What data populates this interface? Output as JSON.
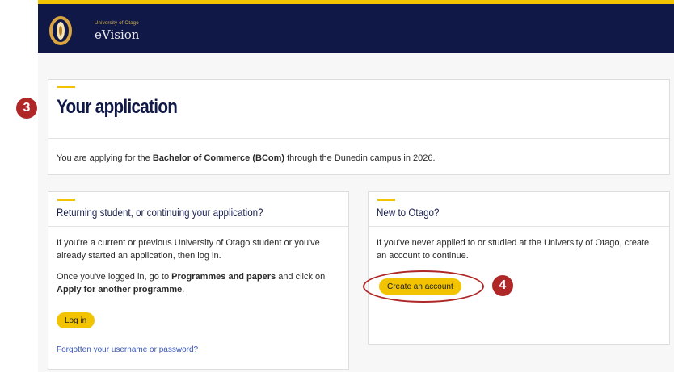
{
  "header": {
    "university_name": "University of Otago",
    "product_name": "eVision",
    "logo_icon": "otago-crest-icon",
    "colors": {
      "navy": "#0f1847",
      "gold": "#f2c300"
    }
  },
  "main": {
    "title": "Your application",
    "applying_prefix": "You are applying for the ",
    "programme": "Bachelor of Commerce (BCom)",
    "applying_suffix": " through the Dunedin campus in 2026."
  },
  "returning": {
    "title": "Returning student, or continuing your application?",
    "intro": "If you're a current or previous University of Otago student or you've already started an application, then log in.",
    "instruction_prefix": "Once you've logged in, go to ",
    "instruction_bold1": "Programmes and papers",
    "instruction_middle": " and click on ",
    "instruction_bold2": "Apply for another programme",
    "instruction_suffix": ".",
    "login_label": "Log in",
    "forgot_link": "Forgotten your username or password?"
  },
  "new_user": {
    "title": "New to Otago?",
    "intro": "If you've never applied to or studied at the University of Otago, create an account to continue.",
    "create_label": "Create an account"
  },
  "annotations": {
    "step3": "3",
    "step4": "4",
    "badge_color": "#b02727"
  }
}
